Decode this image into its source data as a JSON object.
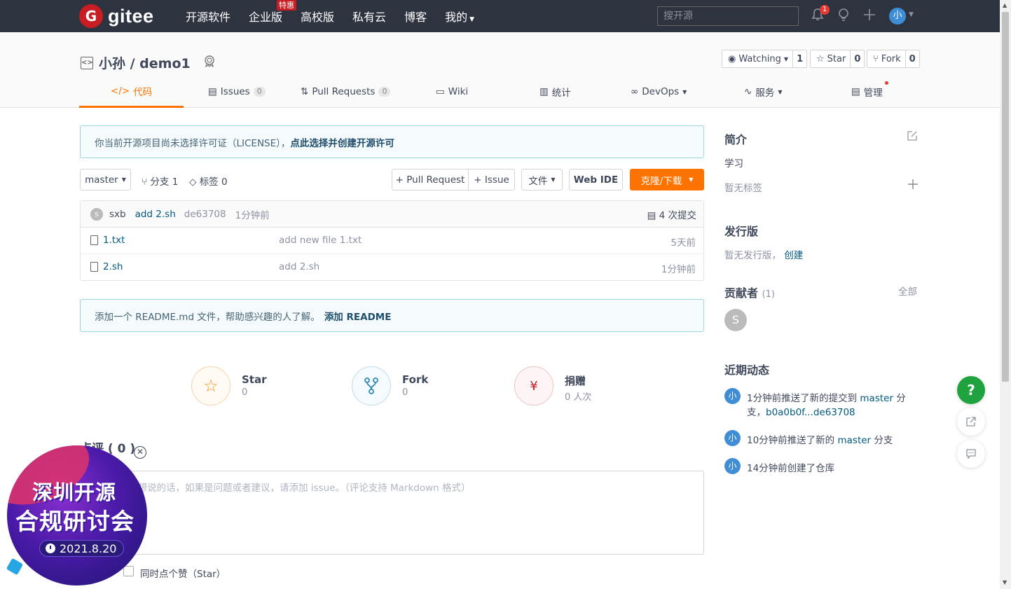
{
  "topbar": {
    "logo_mark": "G",
    "logo_text": "gitee",
    "nav": [
      "开源软件",
      "企业版",
      "高校版",
      "私有云",
      "博客",
      "我的"
    ],
    "nav_badge": "特惠",
    "search_placeholder": "搜开源",
    "notification_count": "1",
    "avatar": "小"
  },
  "repo": {
    "title": "小孙 / demo1",
    "watch_label": "Watching",
    "watch_count": "1",
    "star_label": "Star",
    "star_count": "0",
    "fork_label": "Fork",
    "fork_count": "0"
  },
  "tabs": [
    {
      "label": "代码",
      "icon": "code-icon"
    },
    {
      "label": "Issues",
      "count": "0",
      "icon": "issues-icon"
    },
    {
      "label": "Pull Requests",
      "count": "0",
      "icon": "pull-request-icon"
    },
    {
      "label": "Wiki",
      "icon": "wiki-icon"
    },
    {
      "label": "统计",
      "icon": "chart-icon"
    },
    {
      "label": "DevOps",
      "icon": "infinity-icon"
    },
    {
      "label": "服务",
      "icon": "pulse-icon"
    },
    {
      "label": "管理",
      "icon": "manage-icon"
    }
  ],
  "license": {
    "text": "你当前开源项目尚未选择许可证（LICENSE），",
    "link": "点此选择并创建开源许可"
  },
  "toolbar": {
    "branch": "master",
    "branches": "分支 1",
    "tags": "标签 0",
    "pull_request": "+ Pull Request",
    "issue": "+ Issue",
    "file": "文件",
    "web_ide": "Web IDE",
    "clone": "克隆/下载"
  },
  "commit": {
    "avatar": "s",
    "author": "sxb",
    "message": "add 2.sh",
    "hash": "de63708",
    "time": "1分钟前",
    "commits": "4 次提交"
  },
  "files": [
    {
      "name": "1.txt",
      "message": "add new file 1.txt",
      "time": "5天前"
    },
    {
      "name": "2.sh",
      "message": "add 2.sh",
      "time": "1分钟前"
    }
  ],
  "readme": {
    "text": "添加一个 README.md 文件，帮助感兴趣的人了解。",
    "link": "添加 README"
  },
  "stats": {
    "star_label": "Star",
    "star_value": "0",
    "fork_label": "Fork",
    "fork_value": "0",
    "donate_label": "捐赠",
    "donate_value": "0 人次"
  },
  "comment": {
    "title": "点评 ( 0 )",
    "placeholder": "在此输入你想说的话，如果是问题或者建议，请添加 issue。（评论支持 Markdown 格式）",
    "star_checkbox": "同时点个赞（Star）"
  },
  "sidebar": {
    "intro_title": "简介",
    "intro_text": "学习",
    "no_tags": "暂无标签",
    "release_title": "发行版",
    "no_release": "暂无发行版，",
    "create": "创建",
    "contrib_title": "贡献者",
    "contrib_count": "(1)",
    "all": "全部",
    "contrib_avatar": "S",
    "activity_title": "近期动态",
    "activities": [
      {
        "avatar": "小",
        "p1": "1分钟前推送了新的提交到 ",
        "link1": "master",
        "p2": " 分",
        "line2a": "支，",
        "link2": "b0a0b0f...de63708"
      },
      {
        "avatar": "小",
        "p1": "10分钟前推送了新的 ",
        "link1": "master",
        "p2": " 分支"
      },
      {
        "avatar": "小",
        "p1": "14分钟前创建了仓库"
      }
    ]
  },
  "float": {
    "help": "?"
  },
  "promo": {
    "line1": "深圳开源",
    "line2": "合规研讨会",
    "date": "2021.8.20"
  }
}
